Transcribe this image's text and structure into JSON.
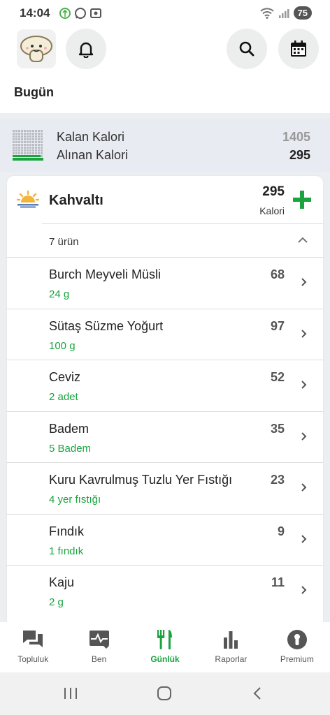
{
  "status": {
    "time": "14:04",
    "battery": "75"
  },
  "header": {
    "title": "Bugün"
  },
  "summary": {
    "remaining_label": "Kalan Kalori",
    "remaining_value": "1405",
    "consumed_label": "Alınan Kalori",
    "consumed_value": "295"
  },
  "meal": {
    "name": "Kahvaltı",
    "calories": "295",
    "calories_unit": "Kalori",
    "count_label": "7 ürün",
    "items": [
      {
        "name": "Burch Meyveli Müsli",
        "qty": "24 g",
        "cal": "68"
      },
      {
        "name": "Sütaş Süzme Yoğurt",
        "qty": "100 g",
        "cal": "97"
      },
      {
        "name": "Ceviz",
        "qty": "2 adet",
        "cal": "52"
      },
      {
        "name": "Badem",
        "qty": "5 Badem",
        "cal": "35"
      },
      {
        "name": "Kuru Kavrulmuş Tuzlu Yer Fıstığı",
        "qty": "4 yer fıstığı",
        "cal": "23"
      },
      {
        "name": "Fındık",
        "qty": "1 fındık",
        "cal": "9"
      },
      {
        "name": "Kaju",
        "qty": "2 g",
        "cal": "11"
      }
    ]
  },
  "nav": {
    "items": [
      {
        "label": "Topluluk",
        "icon": "chat-icon"
      },
      {
        "label": "Ben",
        "icon": "heart-monitor-icon"
      },
      {
        "label": "Günlük",
        "icon": "utensils-icon"
      },
      {
        "label": "Raporlar",
        "icon": "bar-chart-icon"
      },
      {
        "label": "Premium",
        "icon": "premium-icon"
      }
    ]
  },
  "colors": {
    "accent": "#1aa33f",
    "text": "#222222",
    "muted": "#555555"
  }
}
